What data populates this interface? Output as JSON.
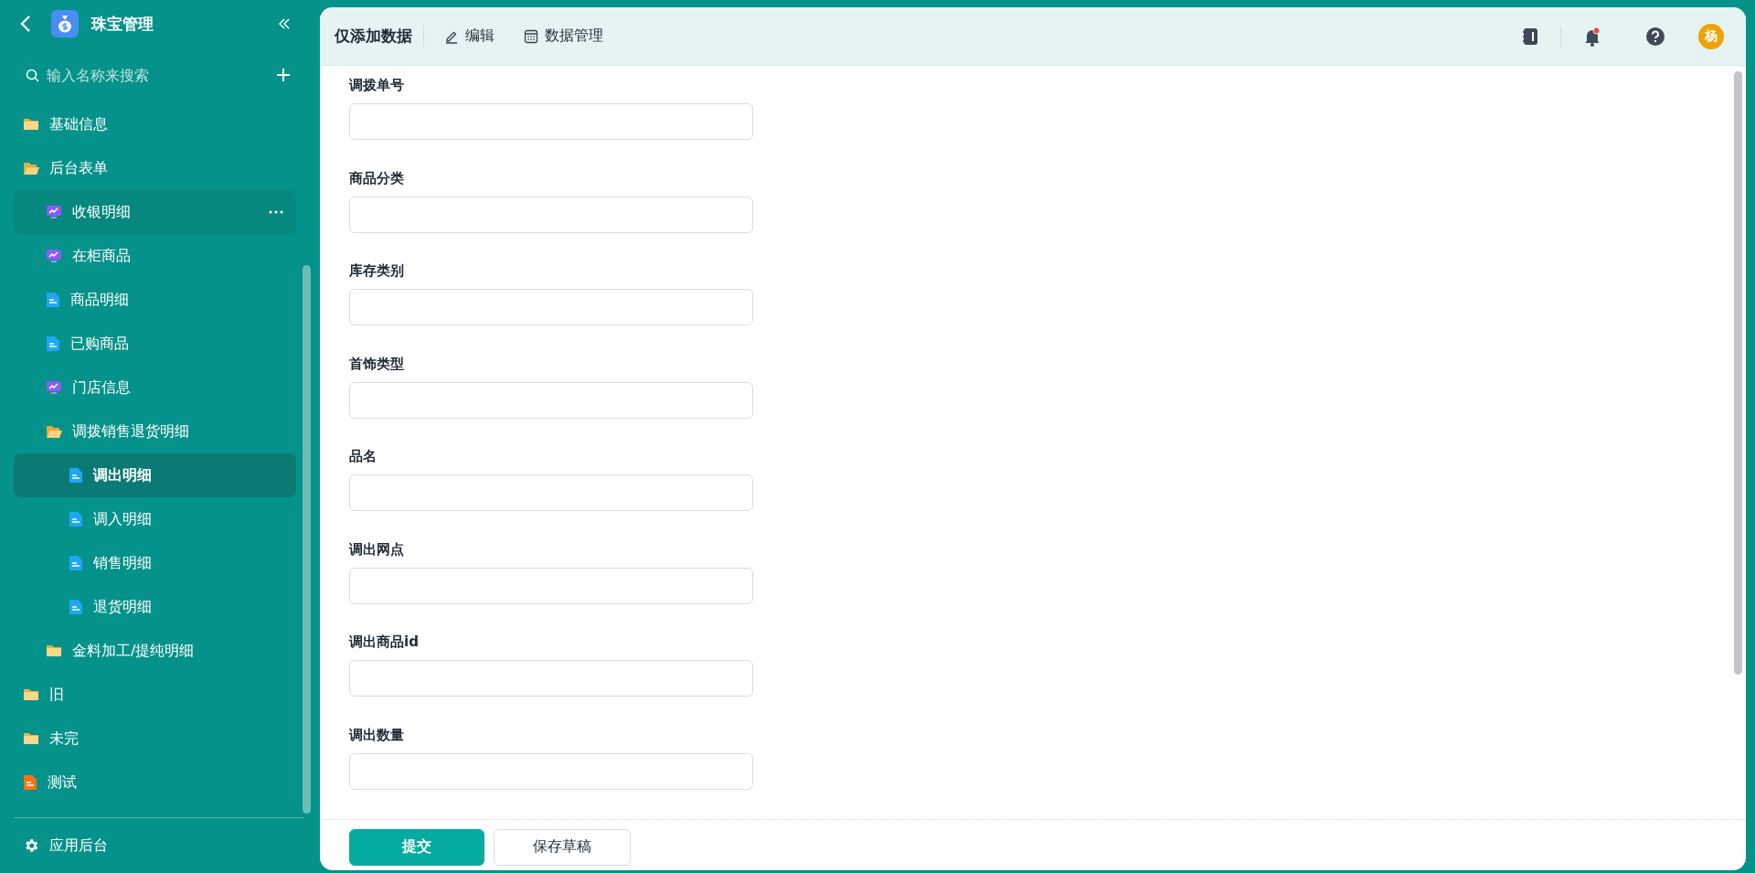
{
  "app": {
    "title": "珠宝管理"
  },
  "sidebar": {
    "search": {
      "placeholder": "输入名称来搜索"
    },
    "items": [
      {
        "label": "基础信息",
        "kind": "folder",
        "expanded": false,
        "selected": false,
        "hovered": false
      },
      {
        "label": "后台表单",
        "kind": "folder",
        "expanded": true,
        "selected": false,
        "hovered": false,
        "children": [
          {
            "label": "收银明细",
            "kind": "chart",
            "selected": false,
            "hovered": true
          },
          {
            "label": "在柜商品",
            "kind": "chart",
            "selected": false,
            "hovered": false
          },
          {
            "label": "商品明细",
            "kind": "doc",
            "selected": false,
            "hovered": false
          },
          {
            "label": "已购商品",
            "kind": "doc",
            "selected": false,
            "hovered": false
          },
          {
            "label": "门店信息",
            "kind": "chart",
            "selected": false,
            "hovered": false
          },
          {
            "label": "调拨销售退货明细",
            "kind": "folder",
            "expanded": true,
            "selected": false,
            "hovered": false,
            "children": [
              {
                "label": "调出明细",
                "kind": "doc",
                "selected": true,
                "hovered": false
              },
              {
                "label": "调入明细",
                "kind": "doc",
                "selected": false,
                "hovered": false
              },
              {
                "label": "销售明细",
                "kind": "doc",
                "selected": false,
                "hovered": false
              },
              {
                "label": "退货明细",
                "kind": "doc",
                "selected": false,
                "hovered": false
              }
            ]
          },
          {
            "label": "金料加工/提纯明细",
            "kind": "folder",
            "expanded": false,
            "selected": false,
            "hovered": false
          }
        ]
      },
      {
        "label": "旧",
        "kind": "folder",
        "expanded": false,
        "selected": false,
        "hovered": false
      },
      {
        "label": "未完",
        "kind": "folder",
        "expanded": false,
        "selected": false,
        "hovered": false
      },
      {
        "label": "测试",
        "kind": "sheet",
        "selected": false,
        "hovered": false
      }
    ],
    "footer": {
      "label": "应用后台"
    }
  },
  "toolbar": {
    "title": "仅添加数据",
    "actions": [
      {
        "label": "编辑",
        "kind": "edit"
      },
      {
        "label": "数据管理",
        "kind": "table"
      }
    ],
    "notifications_unread": true,
    "avatar": "杨"
  },
  "form": {
    "fields": [
      {
        "label": "调拨单号"
      },
      {
        "label": "商品分类"
      },
      {
        "label": "库存类别"
      },
      {
        "label": "首饰类型"
      },
      {
        "label": "品名"
      },
      {
        "label": "调出网点"
      },
      {
        "label": "调出商品id"
      },
      {
        "label": "调出数量"
      }
    ],
    "buttons": [
      {
        "label": "提交",
        "kind": "primary"
      },
      {
        "label": "保存草稿",
        "kind": "default"
      }
    ]
  }
}
